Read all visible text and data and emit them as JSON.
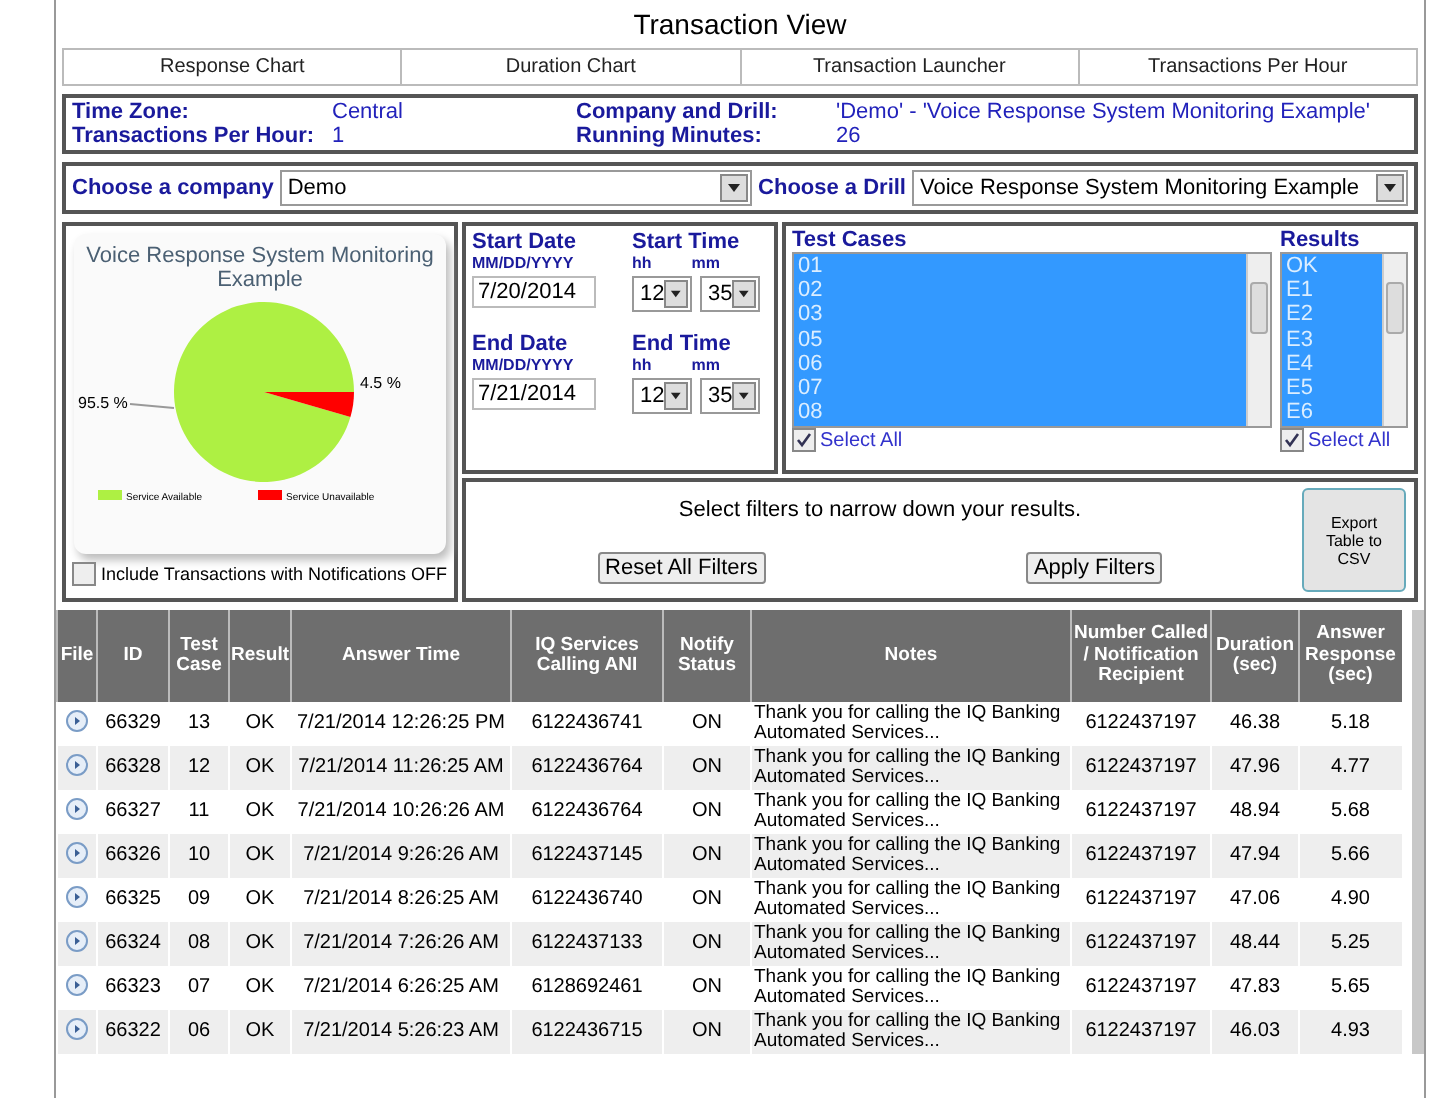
{
  "title": "Transaction View",
  "tabs": [
    {
      "label": "Response Chart"
    },
    {
      "label": "Duration Chart"
    },
    {
      "label": "Transaction Launcher"
    },
    {
      "label": "Transactions Per Hour"
    }
  ],
  "info": [
    {
      "label": "Time Zone:",
      "value": "Central"
    },
    {
      "label": "Company and Drill:",
      "value": "'Demo' - 'Voice Response System Monitoring Example'"
    },
    {
      "label": "Transactions Per Hour:",
      "value": "1"
    },
    {
      "label": "Running Minutes:",
      "value": "26"
    }
  ],
  "company": {
    "label": "Choose a company",
    "value": "Demo"
  },
  "drill": {
    "label": "Choose a Drill",
    "value": "Voice Response System Monitoring Example"
  },
  "chart": {
    "chart_data": {
      "type": "pie",
      "title": "Voice Response System Monitoring Example",
      "categories": [
        "Service Available",
        "Service Unavailable"
      ],
      "values": [
        95.5,
        4.5
      ],
      "value_labels": [
        "95.5 %",
        "4.5 %"
      ],
      "legend": "bottom"
    },
    "include_off": {
      "label": "Include Transactions with Notifications OFF",
      "checked": false
    }
  },
  "start": {
    "date_label": "Start Date",
    "format": "MM/DD/YYYY",
    "date": "7/20/2014",
    "time_label": "Start Time",
    "hh_label": "hh",
    "mm_label": "mm",
    "hh": "12",
    "mm": "35"
  },
  "end": {
    "date_label": "End Date",
    "format": "MM/DD/YYYY",
    "date": "7/21/2014",
    "time_label": "End Time",
    "hh_label": "hh",
    "mm_label": "mm",
    "hh": "12",
    "mm": "35"
  },
  "test_cases": {
    "label": "Test Cases",
    "items": [
      {
        "label": "01",
        "selected": true
      },
      {
        "label": "02",
        "selected": true
      },
      {
        "label": "03",
        "selected": true
      },
      {
        "label": "05",
        "selected": true
      },
      {
        "label": "06",
        "selected": true
      },
      {
        "label": "07",
        "selected": true
      },
      {
        "label": "08",
        "selected": true
      }
    ],
    "select_all": {
      "label": "Select All",
      "checked": true
    }
  },
  "results": {
    "label": "Results",
    "items": [
      {
        "label": "OK",
        "selected": true
      },
      {
        "label": "E1",
        "selected": true
      },
      {
        "label": "E2",
        "selected": true
      },
      {
        "label": "E3",
        "selected": true
      },
      {
        "label": "E4",
        "selected": true
      },
      {
        "label": "E5",
        "selected": true
      },
      {
        "label": "E6",
        "selected": true
      }
    ],
    "select_all": {
      "label": "Select All",
      "checked": true
    }
  },
  "filters": {
    "message": "Select filters to narrow down your results.",
    "reset": "Reset All Filters",
    "apply": "Apply Filters",
    "export": "Export Table to CSV"
  },
  "table": {
    "columns": [
      "File",
      "ID",
      "Test Case",
      "Result",
      "Answer Time",
      "IQ Services Calling ANI",
      "Notify Status",
      "Notes",
      "Number Called / Notification Recipient",
      "Duration (sec)",
      "Answer Response (sec)"
    ],
    "rows": [
      [
        "",
        "66329",
        "13",
        "OK",
        "7/21/2014 12:26:25 PM",
        "6122436741",
        "ON",
        "Thank you for calling the IQ Banking Automated Services...",
        "6122437197",
        "46.38",
        "5.18"
      ],
      [
        "",
        "66328",
        "12",
        "OK",
        "7/21/2014 11:26:25 AM",
        "6122436764",
        "ON",
        "Thank you for calling the IQ Banking Automated Services...",
        "6122437197",
        "47.96",
        "4.77"
      ],
      [
        "",
        "66327",
        "11",
        "OK",
        "7/21/2014 10:26:26 AM",
        "6122436764",
        "ON",
        "Thank you for calling the IQ Banking Automated Services...",
        "6122437197",
        "48.94",
        "5.68"
      ],
      [
        "",
        "66326",
        "10",
        "OK",
        "7/21/2014 9:26:26 AM",
        "6122437145",
        "ON",
        "Thank you for calling the IQ Banking Automated Services...",
        "6122437197",
        "47.94",
        "5.66"
      ],
      [
        "",
        "66325",
        "09",
        "OK",
        "7/21/2014 8:26:25 AM",
        "6122436740",
        "ON",
        "Thank you for calling the IQ Banking Automated Services...",
        "6122437197",
        "47.06",
        "4.90"
      ],
      [
        "",
        "66324",
        "08",
        "OK",
        "7/21/2014 7:26:26 AM",
        "6122437133",
        "ON",
        "Thank you for calling the IQ Banking Automated Services...",
        "6122437197",
        "48.44",
        "5.25"
      ],
      [
        "",
        "66323",
        "07",
        "OK",
        "7/21/2014 6:26:25 AM",
        "6128692461",
        "ON",
        "Thank you for calling the IQ Banking Automated Services...",
        "6122437197",
        "47.83",
        "5.65"
      ],
      [
        "",
        "66322",
        "06",
        "OK",
        "7/21/2014 5:26:23 AM",
        "6122436715",
        "ON",
        "Thank you for calling the IQ Banking Automated Services...",
        "6122437197",
        "46.03",
        "4.93"
      ]
    ]
  }
}
